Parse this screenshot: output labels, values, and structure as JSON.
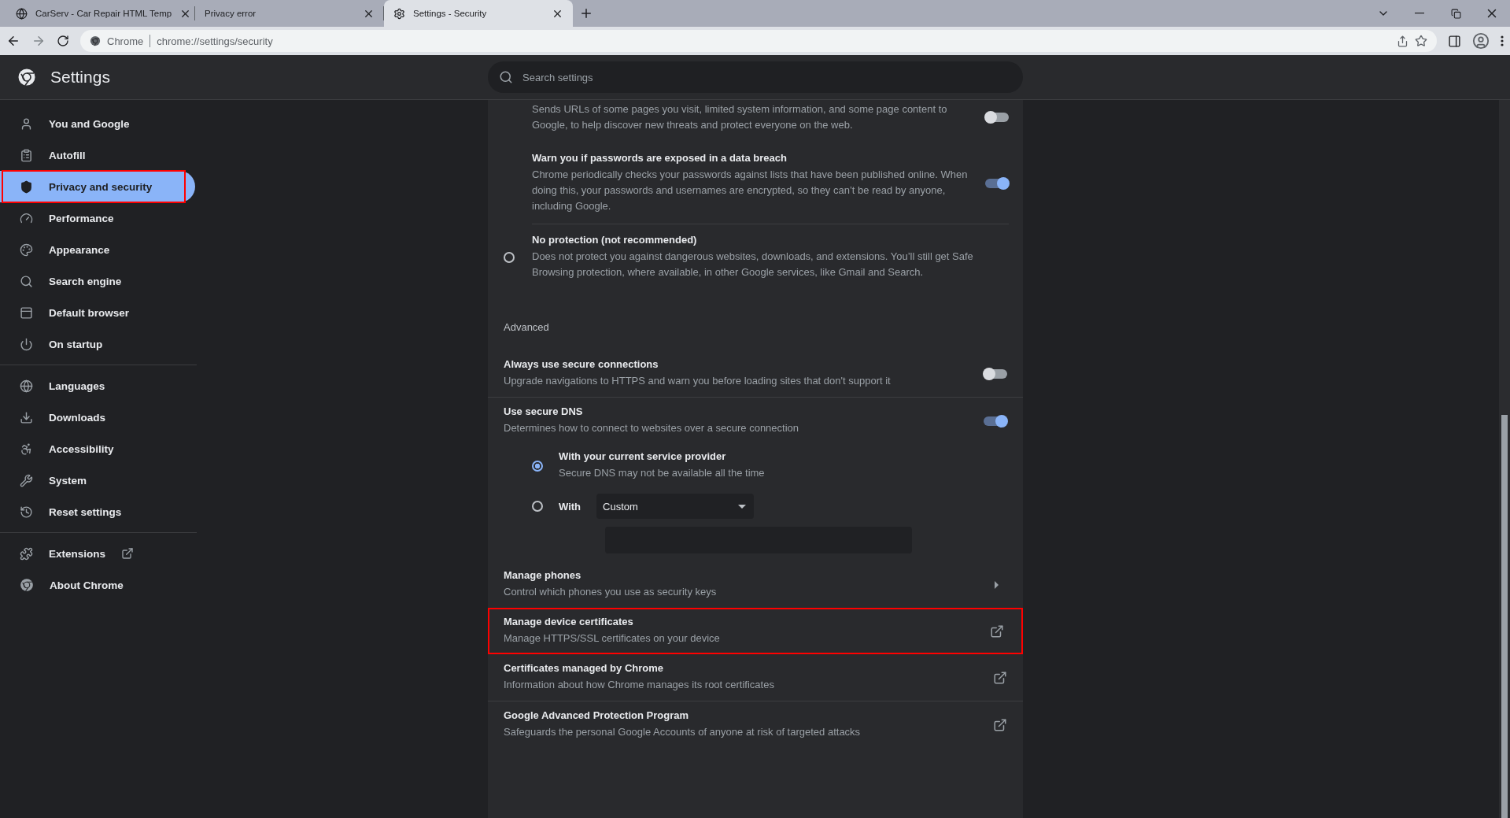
{
  "tabs": [
    {
      "title": "CarServ - Car Repair HTML Temp",
      "selected": false
    },
    {
      "title": "Privacy error",
      "selected": false
    },
    {
      "title": "Settings - Security",
      "selected": true
    }
  ],
  "address_bar": {
    "site_label": "Chrome",
    "url": "chrome://settings/security"
  },
  "header": {
    "title": "Settings",
    "search": {
      "placeholder": "Search settings"
    }
  },
  "sidebar": {
    "groups": [
      {
        "items": [
          {
            "label": "You and Google",
            "selected": false,
            "highlighted": false
          },
          {
            "label": "Autofill",
            "selected": false,
            "highlighted": false
          },
          {
            "label": "Privacy and security",
            "selected": true,
            "highlighted": true
          },
          {
            "label": "Performance",
            "selected": false,
            "highlighted": false
          },
          {
            "label": "Appearance",
            "selected": false,
            "highlighted": false
          },
          {
            "label": "Search engine",
            "selected": false,
            "highlighted": false
          },
          {
            "label": "Default browser",
            "selected": false,
            "highlighted": false
          },
          {
            "label": "On startup",
            "selected": false,
            "highlighted": false
          }
        ]
      },
      {
        "items": [
          {
            "label": "Languages",
            "selected": false,
            "highlighted": false
          },
          {
            "label": "Downloads",
            "selected": false,
            "highlighted": false
          },
          {
            "label": "Accessibility",
            "selected": false,
            "highlighted": false
          },
          {
            "label": "System",
            "selected": false,
            "highlighted": false
          },
          {
            "label": "Reset settings",
            "selected": false,
            "highlighted": false
          }
        ]
      },
      {
        "items": [
          {
            "label": "Extensions",
            "selected": false,
            "highlighted": false,
            "external": true
          },
          {
            "label": "About Chrome",
            "selected": false,
            "highlighted": false,
            "external": false
          }
        ]
      }
    ]
  },
  "safe_browsing": {
    "sub_toggles": [
      {
        "description": "Sends URLs of some pages you visit, limited system information, and some page content to Google, to help discover new threats and protect everyone on the web.",
        "on": false
      },
      {
        "title": "Warn you if passwords are exposed in a data breach",
        "description": "Chrome periodically checks your passwords against lists that have been published online. When doing this, your passwords and usernames are encrypted, so they can’t be read by anyone, including Google.",
        "on": true
      }
    ],
    "no_protection": {
      "title": "No protection (not recommended)",
      "description": "Does not protect you against dangerous websites, downloads, and extensions. You’ll still get Safe Browsing protection, where available, in other Google services, like Gmail and Search.",
      "selected": false
    }
  },
  "advanced": {
    "heading": "Advanced",
    "rows": [
      {
        "kind": "toggle",
        "title": "Always use secure connections",
        "description": "Upgrade navigations to HTTPS and warn you before loading sites that don't support it",
        "on": false,
        "highlighted": false
      },
      {
        "kind": "dns",
        "title": "Use secure DNS",
        "description": "Determines how to connect to websites over a secure connection",
        "on": true,
        "highlighted": false,
        "options": [
          {
            "title": "With your current service provider",
            "description": "Secure DNS may not be available all the time",
            "selected": true
          },
          {
            "label": "With",
            "value": "Custom",
            "selected": false
          }
        ]
      },
      {
        "kind": "arrow",
        "title": "Manage phones",
        "description": "Control which phones you use as security keys",
        "highlighted": false
      },
      {
        "kind": "external",
        "title": "Manage device certificates",
        "description": "Manage HTTPS/SSL certificates on your device",
        "highlighted": true
      },
      {
        "kind": "external",
        "title": "Certificates managed by Chrome",
        "description": "Information about how Chrome manages its root certificates",
        "highlighted": false
      },
      {
        "kind": "external",
        "title": "Google Advanced Protection Program",
        "description": "Safeguards the personal Google Accounts of anyone at risk of targeted attacks",
        "highlighted": false
      }
    ]
  }
}
